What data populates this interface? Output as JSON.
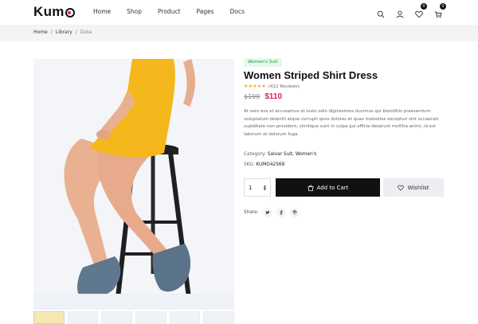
{
  "header": {
    "logo": "Kum",
    "nav": [
      "Home",
      "Shop",
      "Product",
      "Pages",
      "Docs"
    ],
    "wishlist_count": "0",
    "cart_count": "0"
  },
  "breadcrumb": {
    "items": [
      "Home",
      "Library",
      "Data"
    ],
    "separator": "/"
  },
  "product": {
    "tag": "Women's Suit",
    "title": "Women Striped Shirt Dress",
    "stars": "★★★★★",
    "reviews": "(412 Reviews)",
    "old_price": "$199",
    "new_price": "$110",
    "description": "At vero eos et accusamus et iusto odio dignissimos ducimus qui blanditiis praesentium voluptatum deleniti atque corrupti quos dolores et quas molestias excepturi sint occaecati cupiditate non provident, similique sunt in culpa qui officia deserunt mollitia animi, id est laborum et dolorum fuga.",
    "category_label": "Category:",
    "category_value": "Salvar Suit, Women's",
    "sku_label": "SKU:",
    "sku_value": "KUMO42568",
    "quantity": "1",
    "add_to_cart": "Add to Cart",
    "wishlist": "Wishlist",
    "share_label": "Share:",
    "share_icons": [
      "twitter",
      "facebook",
      "pinterest"
    ]
  },
  "colors": {
    "accent": "#e11d48",
    "tag_bg": "#e7f7ea",
    "tag_text": "#1a9c3c",
    "dress": "#f5b81c",
    "star": "#f5a623"
  }
}
